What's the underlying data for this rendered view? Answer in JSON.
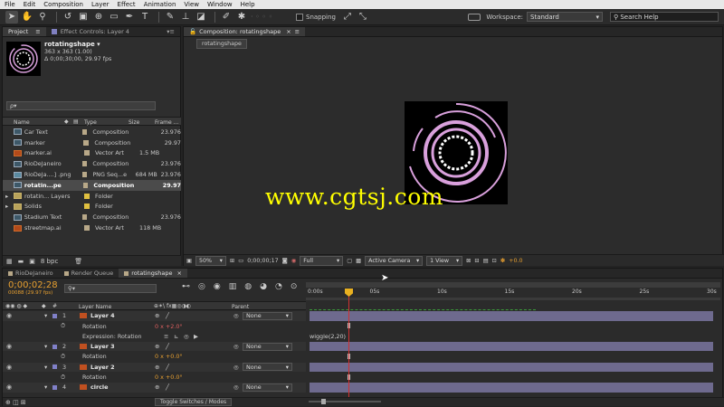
{
  "menu": [
    "File",
    "Edit",
    "Composition",
    "Layer",
    "Effect",
    "Animation",
    "View",
    "Window",
    "Help"
  ],
  "toolbar": {
    "snapping_label": "Snapping",
    "workspace_label": "Workspace:",
    "workspace_value": "Standard",
    "search_placeholder": "Search Help"
  },
  "project_panel": {
    "tab_project": "Project",
    "tab_effect_controls": "Effect Controls: Layer 4",
    "selected_name": "rotatingshape",
    "selected_dims": "363 x 363 (1.00)",
    "selected_duration": "Δ 0;00;30;00, 29.97 fps",
    "search_placeholder": "ρ▾",
    "columns": [
      "Name",
      "Type",
      "Size",
      "Frame ..."
    ],
    "items": [
      {
        "name": "Car Text",
        "type": "Composition",
        "size": "",
        "fps": "23.976",
        "icon": "comp",
        "color": "#b8a888"
      },
      {
        "name": "marker",
        "type": "Composition",
        "size": "",
        "fps": "29.97",
        "icon": "comp",
        "color": "#b8a888"
      },
      {
        "name": "marker.ai",
        "type": "Vector Art",
        "size": "1.5 MB",
        "fps": "",
        "icon": "ai",
        "color": "#b8a888"
      },
      {
        "name": "RioDeJaneiro",
        "type": "Composition",
        "size": "",
        "fps": "23.976",
        "icon": "comp",
        "color": "#b8a888"
      },
      {
        "name": "RioDeJa....] .png",
        "type": "PNG Seq...e",
        "size": "684 MB",
        "fps": "23.976",
        "icon": "png",
        "color": "#b8a888"
      },
      {
        "name": "rotatin...pe",
        "type": "Composition",
        "size": "",
        "fps": "29.97",
        "icon": "comp",
        "color": "#b8a888",
        "selected": true
      },
      {
        "name": "rotatin... Layers",
        "type": "Folder",
        "size": "",
        "fps": "",
        "icon": "folder",
        "color": "#e0c040"
      },
      {
        "name": "Solids",
        "type": "Folder",
        "size": "",
        "fps": "",
        "icon": "folder",
        "color": "#e0c040"
      },
      {
        "name": "Stadium Text",
        "type": "Composition",
        "size": "",
        "fps": "23.976",
        "icon": "comp",
        "color": "#b8a888"
      },
      {
        "name": "streetmap.ai",
        "type": "Vector Art",
        "size": "118 MB",
        "fps": "",
        "icon": "ai",
        "color": "#b8a888"
      }
    ],
    "bpc_label": "8 bpc"
  },
  "composition_panel": {
    "tab_label": "Composition: rotatingshape",
    "subtab_label": "rotatingshape",
    "watermark": "www.cgtsj.com",
    "zoom": "50%",
    "timecode": "0;00;00;17",
    "resolution": "Full",
    "camera": "Active Camera",
    "view": "1 View",
    "exposure": "+0.0"
  },
  "timeline": {
    "tabs": [
      "RioDeJaneiro",
      "Render Queue",
      "rotatingshape"
    ],
    "timecode": "0;00;02;28",
    "frame_info": "00088 (29.97 fps)",
    "col_layer_name": "Layer Name",
    "col_parent": "Parent",
    "ruler_labels": [
      "0:00s",
      "05s",
      "10s",
      "15s",
      "20s",
      "25s",
      "30s"
    ],
    "rows": [
      {
        "kind": "layer",
        "num": "1",
        "name": "Layer 4",
        "parent": "None"
      },
      {
        "kind": "prop",
        "name": "Rotation",
        "value": "0 x +2.0°",
        "value_red": true
      },
      {
        "kind": "expr",
        "name": "Expression: Rotation",
        "expr": "wiggle(2,20)"
      },
      {
        "kind": "layer",
        "num": "2",
        "name": "Layer 3",
        "parent": "None"
      },
      {
        "kind": "prop",
        "name": "Rotation",
        "value": "0 x +0.0°"
      },
      {
        "kind": "layer",
        "num": "3",
        "name": "Layer 2",
        "parent": "None"
      },
      {
        "kind": "prop",
        "name": "Rotation",
        "value": "0 x +0.0°"
      },
      {
        "kind": "layer",
        "num": "4",
        "name": "circle",
        "parent": "None"
      }
    ],
    "toggle_label": "Toggle Switches / Modes"
  },
  "colors": {
    "accent": "#e8a030",
    "layer_bar": "#6e6a8e",
    "ring": "#d9a0dc",
    "playhead": "#d03030"
  }
}
